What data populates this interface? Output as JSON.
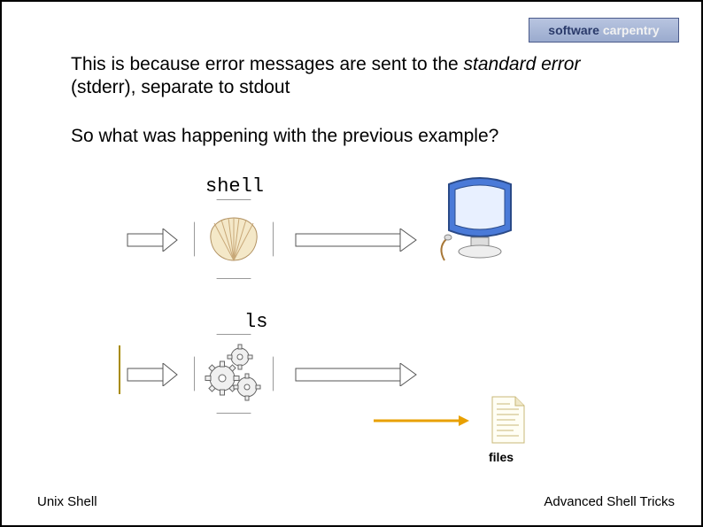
{
  "logo": {
    "left": "software",
    "right": "carpentry"
  },
  "para1a": "This is because error messages are sent to the ",
  "para1b": "standard error",
  "para1c": " (stderr), separate to stdout",
  "para2": "So what was happening with the previous example?",
  "labels": {
    "shell": "shell",
    "ls": "ls",
    "files": "files"
  },
  "footer": {
    "left": "Unix Shell",
    "right": "Advanced Shell Tricks"
  }
}
